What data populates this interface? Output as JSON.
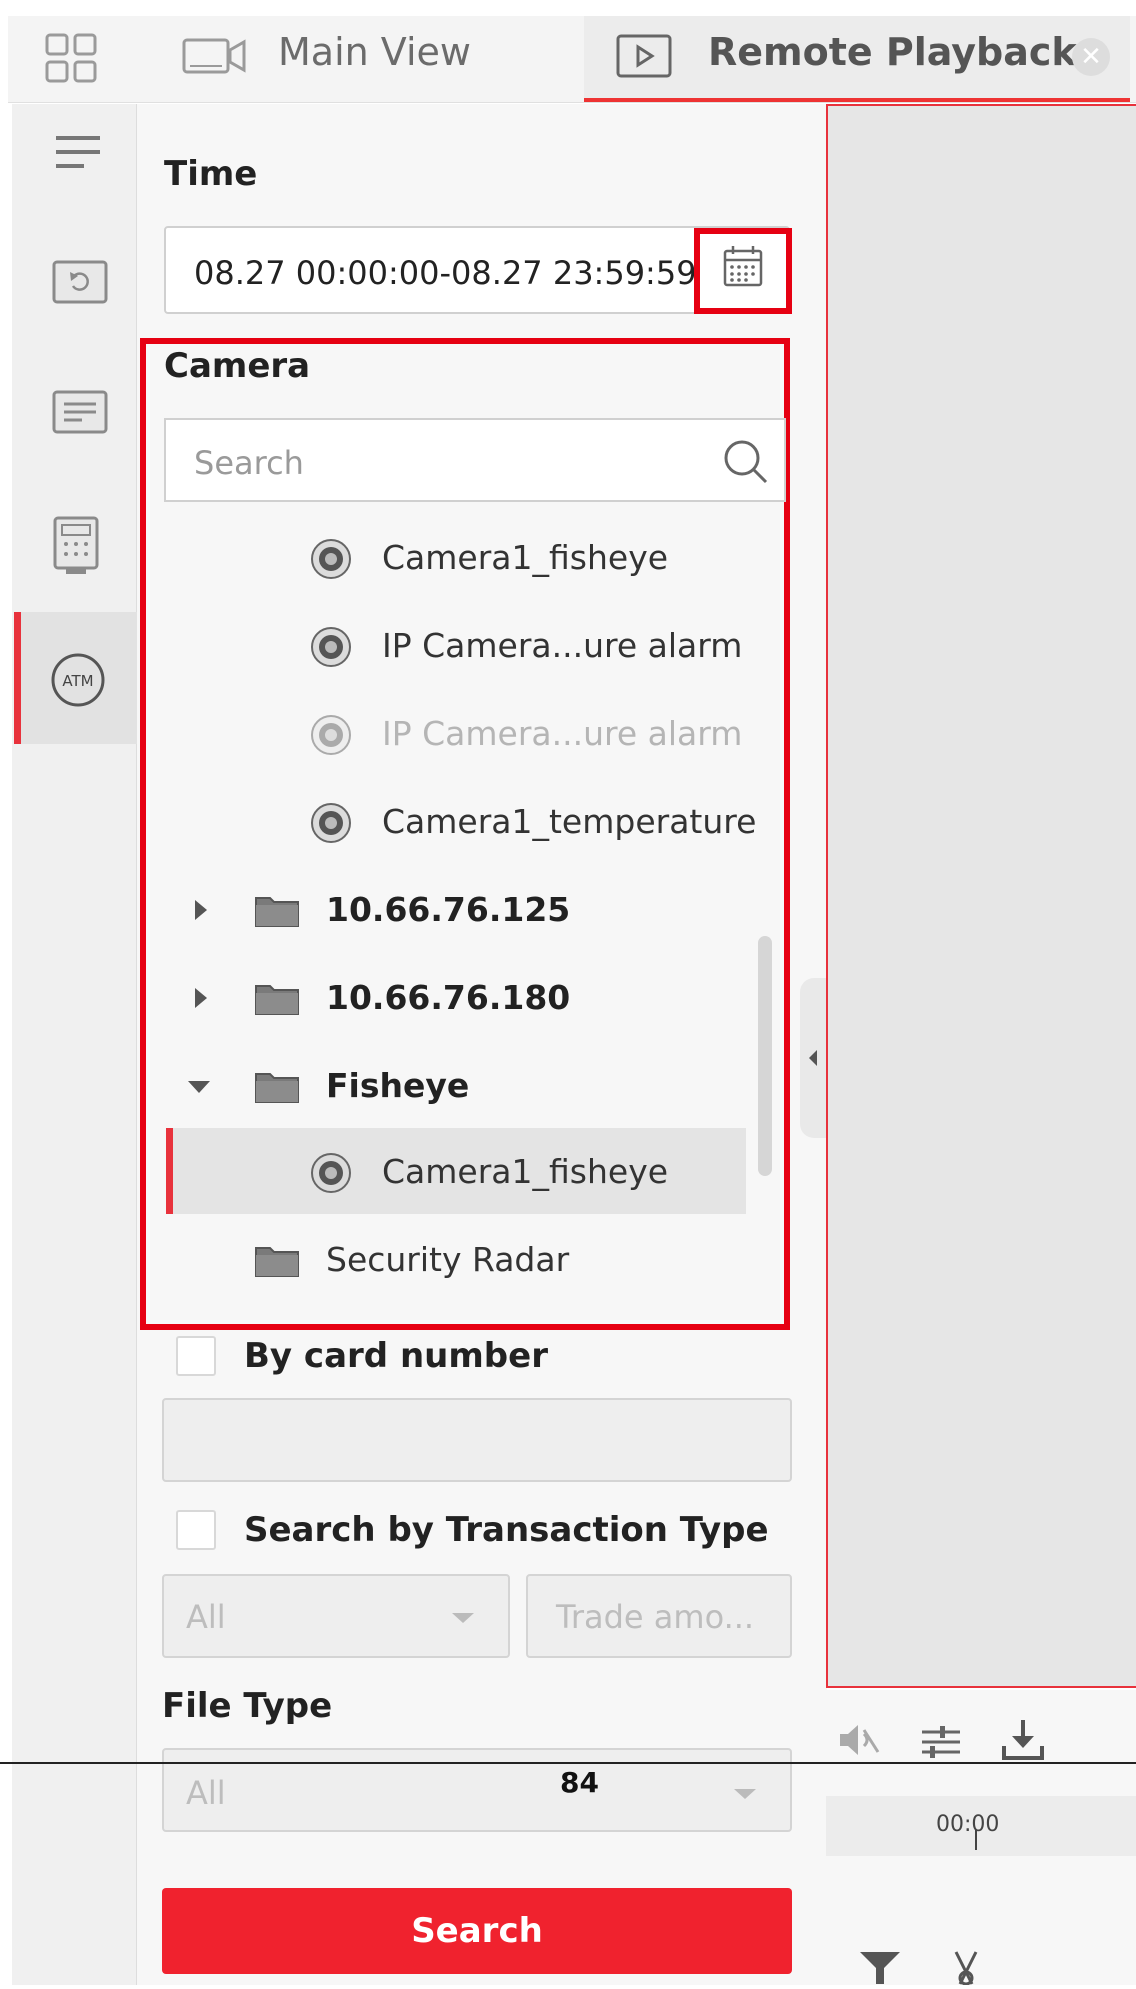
{
  "tabs": {
    "main_view": "Main View",
    "remote_playback": "Remote Playback"
  },
  "time": {
    "label": "Time",
    "value": "08.27 00:00:00-08.27 23:59:59"
  },
  "camera": {
    "label": "Camera",
    "search_placeholder": "Search",
    "tree": [
      {
        "label": "Camera1_fisheye",
        "type": "camera",
        "state": "normal"
      },
      {
        "label": "IP Camera...ure alarm",
        "type": "camera",
        "state": "normal"
      },
      {
        "label": "IP Camera...ure alarm",
        "type": "camera",
        "state": "disabled"
      },
      {
        "label": "Camera1_temperature",
        "type": "camera",
        "state": "normal"
      },
      {
        "label": "10.66.76.125",
        "type": "folder",
        "state": "collapsed"
      },
      {
        "label": "10.66.76.180",
        "type": "folder",
        "state": "collapsed"
      },
      {
        "label": "Fisheye",
        "type": "folder",
        "state": "expanded"
      },
      {
        "label": "Camera1_fisheye",
        "type": "camera",
        "state": "selected"
      },
      {
        "label": "Security Radar",
        "type": "folder",
        "state": "leaf"
      }
    ]
  },
  "by_card": {
    "label": "By card number",
    "checked": false
  },
  "transaction": {
    "label": "Search by Transaction Type",
    "checked": false,
    "type_value": "All",
    "amount_placeholder": "Trade amo..."
  },
  "file_type": {
    "label": "File Type",
    "value": "All"
  },
  "search_button": "Search",
  "timeline": {
    "tick": "00:00"
  },
  "page_number": "84",
  "colors": {
    "accent": "#e60012",
    "button": "#f0222e"
  }
}
